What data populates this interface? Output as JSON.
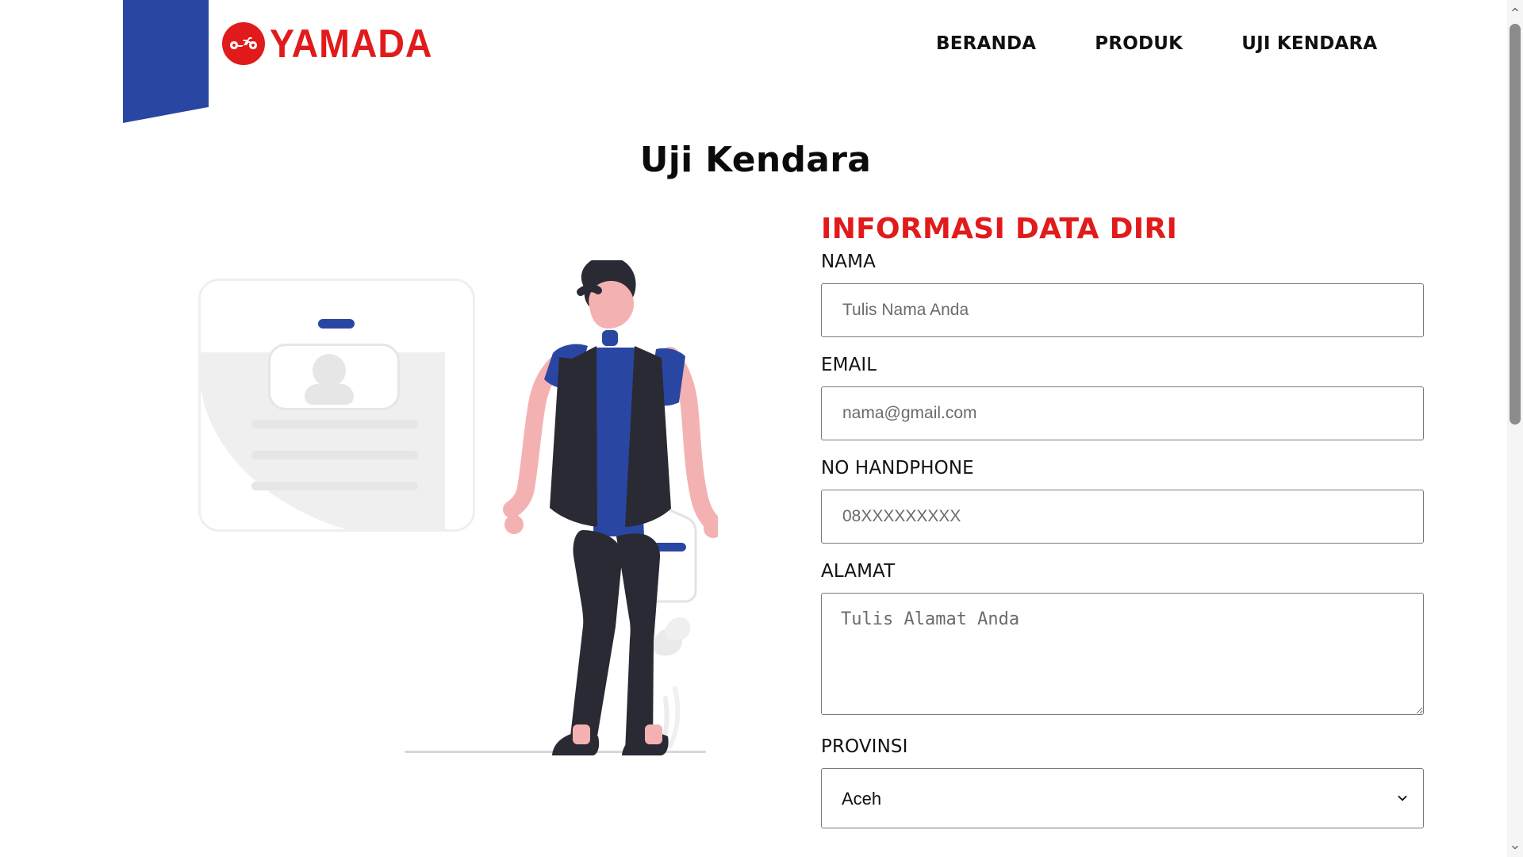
{
  "brand": {
    "name": "YAMADA",
    "colors": {
      "blue": "#2a46a3",
      "red": "#e11b1b"
    },
    "logo_icon": "motorcycle-icon"
  },
  "nav": {
    "items": [
      {
        "label": "BERANDA"
      },
      {
        "label": "PRODUK"
      },
      {
        "label": "UJI KENDARA"
      }
    ]
  },
  "page": {
    "title": "Uji Kendara"
  },
  "form": {
    "section_title": "INFORMASI DATA DIRI",
    "fields": {
      "nama": {
        "label": "NAMA",
        "value": "",
        "placeholder": "Tulis Nama Anda"
      },
      "email": {
        "label": "EMAIL",
        "value": "",
        "placeholder": "nama@gmail.com"
      },
      "phone": {
        "label": "NO HANDPHONE",
        "value": "",
        "placeholder": "08XXXXXXXXX"
      },
      "alamat": {
        "label": "ALAMAT",
        "value": "",
        "placeholder": "Tulis Alamat Anda"
      },
      "provinsi": {
        "label": "PROVINSI",
        "selected": "Aceh"
      }
    }
  },
  "ui": {
    "scrollbar": {
      "up_icon": "chevron-up-icon",
      "down_icon": "chevron-down-icon"
    }
  }
}
